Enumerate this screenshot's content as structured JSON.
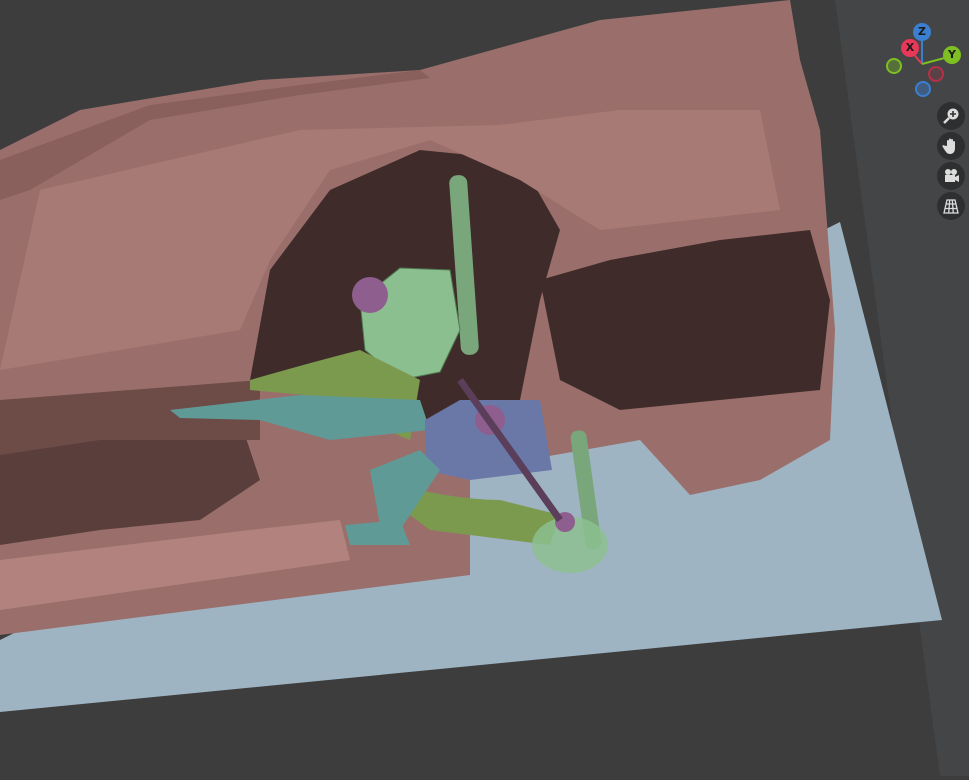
{
  "viewport": {
    "colors": {
      "background": "#3d3d3d",
      "floor": "#9fb4c2",
      "body": "#9a6f6b",
      "body_dark": "#3f2c2a",
      "green": "#7aa67c",
      "teal": "#5f9a96",
      "olive": "#7c9a4e",
      "purple": "#8e5f8e",
      "blue_part": "#6a78a8"
    }
  },
  "gizmo": {
    "x_label": "X",
    "y_label": "Y",
    "z_label": "Z",
    "colors": {
      "x": "#e8385a",
      "y": "#7ec022",
      "z": "#3b7fd1"
    }
  },
  "nav_buttons": [
    {
      "name": "zoom",
      "icon": "zoom-in-icon"
    },
    {
      "name": "pan",
      "icon": "hand-icon"
    },
    {
      "name": "camera",
      "icon": "camera-icon"
    },
    {
      "name": "perspective",
      "icon": "grid-icon"
    }
  ]
}
